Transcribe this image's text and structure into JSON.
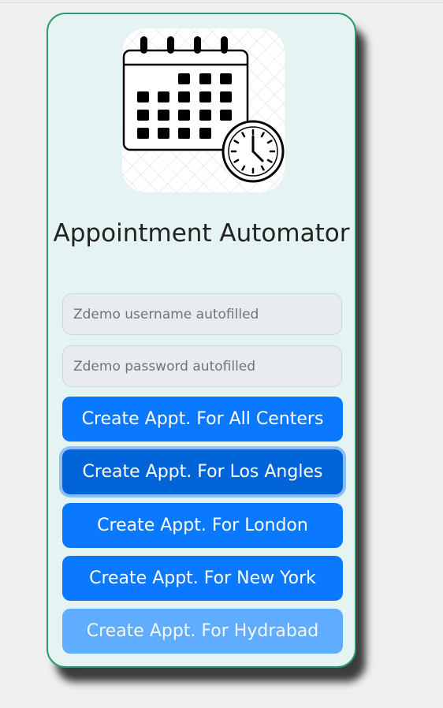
{
  "app": {
    "title": "Appointment Automator",
    "logo_icon": "calendar-clock-icon"
  },
  "form": {
    "username_placeholder": "Zdemo username autofilled",
    "password_placeholder": "Zdemo password autofilled"
  },
  "buttons": {
    "all_centers": "Create Appt. For All Centers",
    "los_angles": "Create Appt. For Los Angles",
    "london": "Create Appt. For London",
    "new_york": "Create Appt. For New York",
    "hydrabad": "Create Appt. For Hydrabad"
  },
  "colors": {
    "card_border": "#2e9a6e",
    "card_background": "#e6f3f3",
    "button_primary": "#0b79ff",
    "button_active": "#0064d8",
    "button_disabled": "#60adff"
  }
}
